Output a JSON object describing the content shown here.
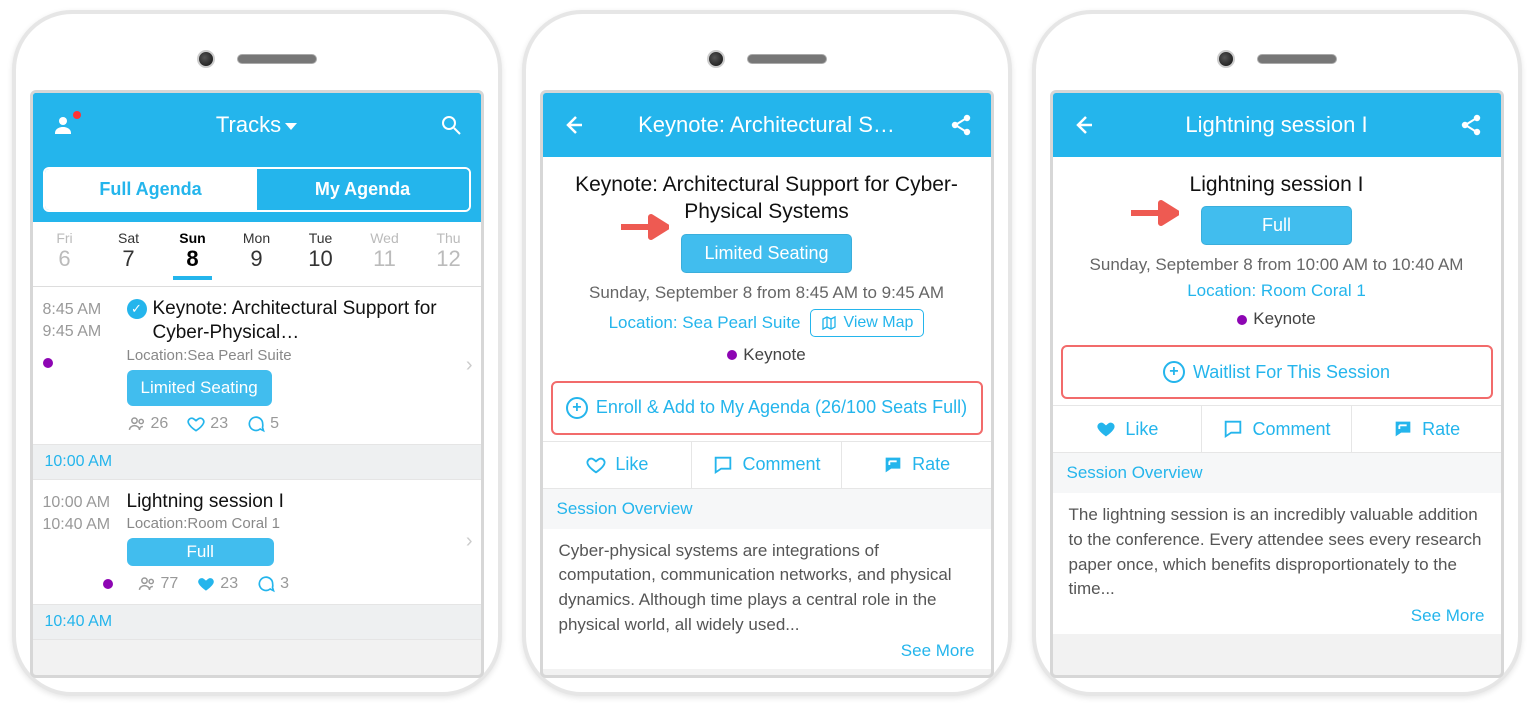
{
  "phone1": {
    "header": {
      "title": "Tracks"
    },
    "tabs": {
      "full": "Full Agenda",
      "my": "My Agenda"
    },
    "dates": [
      {
        "dow": "Fri",
        "num": "6"
      },
      {
        "dow": "Sat",
        "num": "7"
      },
      {
        "dow": "Sun",
        "num": "8"
      },
      {
        "dow": "Mon",
        "num": "9"
      },
      {
        "dow": "Tue",
        "num": "10"
      },
      {
        "dow": "Wed",
        "num": "11"
      },
      {
        "dow": "Thu",
        "num": "12"
      }
    ],
    "session1": {
      "start": "8:45 AM",
      "end": "9:45 AM",
      "title": "Keynote: Architectural Support for Cyber-Physical…",
      "location": "Location:Sea Pearl Suite",
      "badge": "Limited Seating",
      "attendees": "26",
      "likes": "23",
      "comments": "5"
    },
    "separator": "10:00 AM",
    "session2": {
      "start": "10:00 AM",
      "end": "10:40 AM",
      "title": "Lightning session I",
      "location": "Location:Room Coral 1",
      "badge": "Full",
      "attendees": "77",
      "likes": "23",
      "comments": "3"
    },
    "separator2": "10:40 AM"
  },
  "phone2": {
    "header_title": "Keynote: Architectural S…",
    "title": "Keynote: Architectural Support for Cyber-Physical Systems",
    "status": "Limited Seating",
    "datetime": "Sunday, September 8 from 8:45 AM to 9:45 AM",
    "location": "Location: Sea Pearl Suite",
    "viewmap": "View Map",
    "track": "Keynote",
    "enroll": "Enroll & Add to My Agenda (26/100 Seats Full)",
    "actions": {
      "like": "Like",
      "comment": "Comment",
      "rate": "Rate"
    },
    "overview_label": "Session Overview",
    "overview": "Cyber-physical systems are integrations of computation, communication networks, and physical dynamics. Although time plays a central role in the physical world, all widely used...",
    "seemore": "See More"
  },
  "phone3": {
    "header_title": "Lightning session I",
    "title": "Lightning session I",
    "status": "Full",
    "datetime": "Sunday, September 8 from 10:00 AM to 10:40 AM",
    "location": "Location: Room Coral 1",
    "track": "Keynote",
    "enroll": "Waitlist For This Session",
    "actions": {
      "like": "Like",
      "comment": "Comment",
      "rate": "Rate"
    },
    "overview_label": "Session Overview",
    "overview": "The lightning session is an incredibly valuable addition to the conference. Every attendee sees every research paper once, which benefits disproportionately to the time...",
    "seemore": "See More"
  }
}
